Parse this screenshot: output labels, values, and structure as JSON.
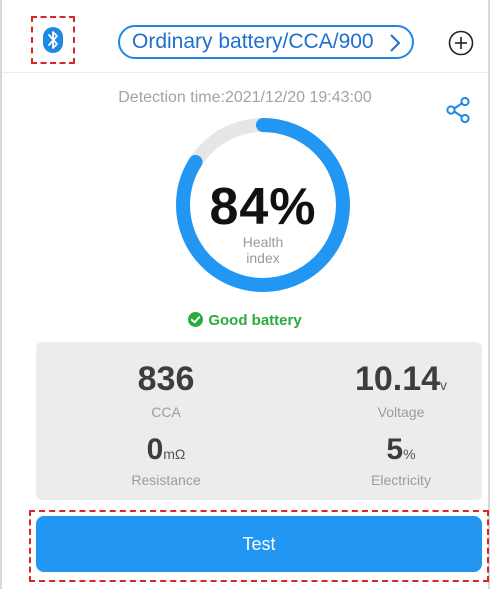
{
  "header": {
    "battery_selector": "Ordinary battery/CCA/900",
    "icons": {
      "bluetooth": "bluetooth-icon",
      "chevron": "chevron-right-icon",
      "add": "add-circle-icon"
    }
  },
  "detection": {
    "time_label": "Detection time:2021/12/20 19:43:00",
    "share_icon": "share-icon"
  },
  "health": {
    "value": "84%",
    "fraction": 0.84,
    "label": "Health index",
    "status": "Good battery",
    "status_icon": "check-circle-icon"
  },
  "stats": {
    "cca": {
      "value": "836",
      "unit": "",
      "label": "CCA"
    },
    "voltage": {
      "value": "10.14",
      "unit": "v",
      "label": "Voltage"
    },
    "resistance": {
      "value": "0",
      "unit": "mΩ",
      "label": "Resistance"
    },
    "electricity": {
      "value": "5",
      "unit": "%",
      "label": "Electricity"
    }
  },
  "actions": {
    "test_label": "Test"
  },
  "colors": {
    "accent": "#2196f3",
    "gauge_track": "#e6e6e6",
    "good": "#2bab3c",
    "highlight": "#d8262b"
  }
}
